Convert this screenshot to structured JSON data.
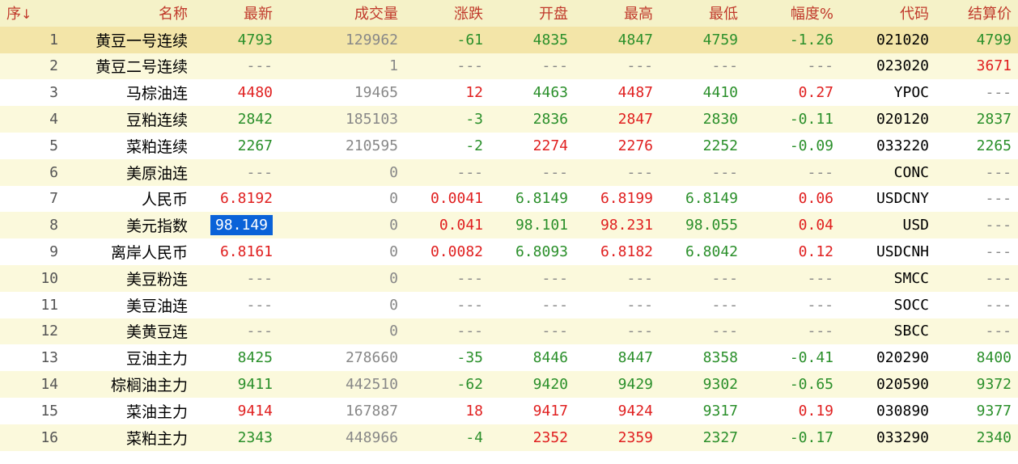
{
  "columns": [
    {
      "key": "idx",
      "label": "序",
      "sort_arrow": "↓"
    },
    {
      "key": "name",
      "label": "名称"
    },
    {
      "key": "last",
      "label": "最新"
    },
    {
      "key": "volume",
      "label": "成交量"
    },
    {
      "key": "change",
      "label": "涨跌"
    },
    {
      "key": "open",
      "label": "开盘"
    },
    {
      "key": "high",
      "label": "最高"
    },
    {
      "key": "low",
      "label": "最低"
    },
    {
      "key": "pct",
      "label": "幅度%"
    },
    {
      "key": "code",
      "label": "代码"
    },
    {
      "key": "settle",
      "label": "结算价"
    }
  ],
  "colors": {
    "up": "#e02020",
    "down": "#2a8f2a",
    "header_text": "#c0392b",
    "header_bg": "#f5f2c8",
    "selected_bg": "#f3e5a8",
    "cell_highlight": "#0a62d8"
  },
  "selected_row": 0,
  "highlighted_cell": {
    "row": 7,
    "col": "last"
  },
  "rows": [
    {
      "idx": "1",
      "name": "黄豆一号连续",
      "last": "4793",
      "volume": "129962",
      "change": "-61",
      "open": "4835",
      "high": "4847",
      "low": "4759",
      "pct": "-1.26",
      "code": "021020",
      "settle": "4799",
      "colors": {
        "last": "green",
        "change": "green",
        "open": "green",
        "high": "green",
        "low": "green",
        "pct": "green",
        "settle": "green"
      }
    },
    {
      "idx": "2",
      "name": "黄豆二号连续",
      "last": "---",
      "volume": "1",
      "change": "---",
      "open": "---",
      "high": "---",
      "low": "---",
      "pct": "---",
      "code": "023020",
      "settle": "3671",
      "colors": {
        "last": "gray",
        "change": "gray",
        "open": "gray",
        "high": "gray",
        "low": "gray",
        "pct": "gray",
        "settle": "red"
      }
    },
    {
      "idx": "3",
      "name": "马棕油连",
      "last": "4480",
      "volume": "19465",
      "change": "12",
      "open": "4463",
      "high": "4487",
      "low": "4410",
      "pct": "0.27",
      "code": "YPOC",
      "settle": "---",
      "colors": {
        "last": "red",
        "change": "red",
        "open": "green",
        "high": "red",
        "low": "green",
        "pct": "red",
        "settle": "gray"
      }
    },
    {
      "idx": "4",
      "name": "豆粕连续",
      "last": "2842",
      "volume": "185103",
      "change": "-3",
      "open": "2836",
      "high": "2847",
      "low": "2830",
      "pct": "-0.11",
      "code": "020120",
      "settle": "2837",
      "colors": {
        "last": "green",
        "change": "green",
        "open": "green",
        "high": "red",
        "low": "green",
        "pct": "green",
        "settle": "green"
      }
    },
    {
      "idx": "5",
      "name": "菜粕连续",
      "last": "2267",
      "volume": "210595",
      "change": "-2",
      "open": "2274",
      "high": "2276",
      "low": "2252",
      "pct": "-0.09",
      "code": "033220",
      "settle": "2265",
      "colors": {
        "last": "green",
        "change": "green",
        "open": "red",
        "high": "red",
        "low": "green",
        "pct": "green",
        "settle": "green"
      }
    },
    {
      "idx": "6",
      "name": "美原油连",
      "last": "---",
      "volume": "0",
      "change": "---",
      "open": "---",
      "high": "---",
      "low": "---",
      "pct": "---",
      "code": "CONC",
      "settle": "---",
      "colors": {
        "last": "gray",
        "change": "gray",
        "open": "gray",
        "high": "gray",
        "low": "gray",
        "pct": "gray",
        "settle": "gray"
      }
    },
    {
      "idx": "7",
      "name": "人民币",
      "last": "6.8192",
      "volume": "0",
      "change": "0.0041",
      "open": "6.8149",
      "high": "6.8199",
      "low": "6.8149",
      "pct": "0.06",
      "code": "USDCNY",
      "settle": "---",
      "colors": {
        "last": "red",
        "change": "red",
        "open": "green",
        "high": "red",
        "low": "green",
        "pct": "red",
        "settle": "gray"
      }
    },
    {
      "idx": "8",
      "name": "美元指数",
      "last": "98.149",
      "volume": "0",
      "change": "0.041",
      "open": "98.101",
      "high": "98.231",
      "low": "98.055",
      "pct": "0.04",
      "code": "USD",
      "settle": "---",
      "colors": {
        "last": "red",
        "change": "red",
        "open": "green",
        "high": "red",
        "low": "green",
        "pct": "red",
        "settle": "gray"
      }
    },
    {
      "idx": "9",
      "name": "离岸人民币",
      "last": "6.8161",
      "volume": "0",
      "change": "0.0082",
      "open": "6.8093",
      "high": "6.8182",
      "low": "6.8042",
      "pct": "0.12",
      "code": "USDCNH",
      "settle": "---",
      "colors": {
        "last": "red",
        "change": "red",
        "open": "green",
        "high": "red",
        "low": "green",
        "pct": "red",
        "settle": "gray"
      }
    },
    {
      "idx": "10",
      "name": "美豆粉连",
      "last": "---",
      "volume": "0",
      "change": "---",
      "open": "---",
      "high": "---",
      "low": "---",
      "pct": "---",
      "code": "SMCC",
      "settle": "---",
      "colors": {
        "last": "gray",
        "change": "gray",
        "open": "gray",
        "high": "gray",
        "low": "gray",
        "pct": "gray",
        "settle": "gray"
      }
    },
    {
      "idx": "11",
      "name": "美豆油连",
      "last": "---",
      "volume": "0",
      "change": "---",
      "open": "---",
      "high": "---",
      "low": "---",
      "pct": "---",
      "code": "SOCC",
      "settle": "---",
      "colors": {
        "last": "gray",
        "change": "gray",
        "open": "gray",
        "high": "gray",
        "low": "gray",
        "pct": "gray",
        "settle": "gray"
      }
    },
    {
      "idx": "12",
      "name": "美黄豆连",
      "last": "---",
      "volume": "0",
      "change": "---",
      "open": "---",
      "high": "---",
      "low": "---",
      "pct": "---",
      "code": "SBCC",
      "settle": "---",
      "colors": {
        "last": "gray",
        "change": "gray",
        "open": "gray",
        "high": "gray",
        "low": "gray",
        "pct": "gray",
        "settle": "gray"
      }
    },
    {
      "idx": "13",
      "name": "豆油主力",
      "last": "8425",
      "volume": "278660",
      "change": "-35",
      "open": "8446",
      "high": "8447",
      "low": "8358",
      "pct": "-0.41",
      "code": "020290",
      "settle": "8400",
      "colors": {
        "last": "green",
        "change": "green",
        "open": "green",
        "high": "green",
        "low": "green",
        "pct": "green",
        "settle": "green"
      }
    },
    {
      "idx": "14",
      "name": "棕榈油主力",
      "last": "9411",
      "volume": "442510",
      "change": "-62",
      "open": "9420",
      "high": "9429",
      "low": "9302",
      "pct": "-0.65",
      "code": "020590",
      "settle": "9372",
      "colors": {
        "last": "green",
        "change": "green",
        "open": "green",
        "high": "green",
        "low": "green",
        "pct": "green",
        "settle": "green"
      }
    },
    {
      "idx": "15",
      "name": "菜油主力",
      "last": "9414",
      "volume": "167887",
      "change": "18",
      "open": "9417",
      "high": "9424",
      "low": "9317",
      "pct": "0.19",
      "code": "030890",
      "settle": "9377",
      "colors": {
        "last": "red",
        "change": "red",
        "open": "red",
        "high": "red",
        "low": "green",
        "pct": "red",
        "settle": "green"
      }
    },
    {
      "idx": "16",
      "name": "菜粕主力",
      "last": "2343",
      "volume": "448966",
      "change": "-4",
      "open": "2352",
      "high": "2359",
      "low": "2327",
      "pct": "-0.17",
      "code": "033290",
      "settle": "2340",
      "colors": {
        "last": "green",
        "change": "green",
        "open": "red",
        "high": "red",
        "low": "green",
        "pct": "green",
        "settle": "green"
      }
    }
  ]
}
